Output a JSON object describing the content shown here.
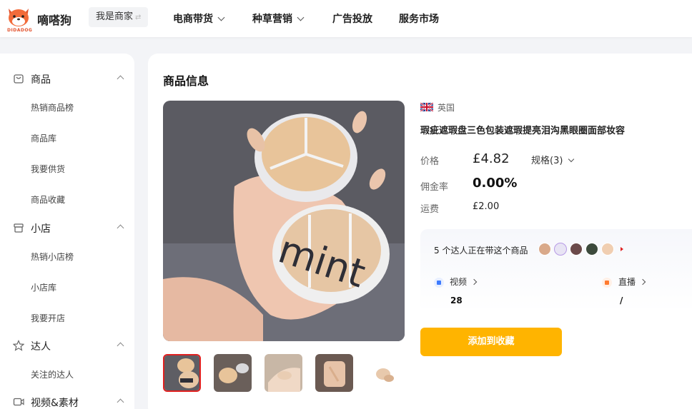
{
  "header": {
    "logo_text": "嘀嗒狗",
    "logo_sub": "DIDADOG",
    "merchant_label": "我是商家",
    "nav": [
      {
        "label": "电商带货",
        "has_dropdown": true
      },
      {
        "label": "种草营销",
        "has_dropdown": true
      },
      {
        "label": "广告投放",
        "has_dropdown": false
      },
      {
        "label": "服务市场",
        "has_dropdown": false
      }
    ]
  },
  "sidebar": {
    "groups": [
      {
        "label": "商品",
        "icon": "bag-icon",
        "items": [
          "热销商品榜",
          "商品库",
          "我要供货",
          "商品收藏"
        ]
      },
      {
        "label": "小店",
        "icon": "store-icon",
        "items": [
          "热销小店榜",
          "小店库",
          "我要开店"
        ]
      },
      {
        "label": "达人",
        "icon": "star-icon",
        "items": [
          "关注的达人"
        ]
      },
      {
        "label": "视频&素材",
        "icon": "video-icon",
        "items": []
      }
    ]
  },
  "product": {
    "section_title": "商品信息",
    "country": "英国",
    "title": "瑕疵遮瑕盘三色包装遮瑕提亮泪沟黑眼圈面部妆容",
    "price_label": "价格",
    "price": "£4.82",
    "spec_label": "规格(3)",
    "commission_label": "佣金率",
    "commission": "0.00%",
    "shipping_label": "运费",
    "shipping": "£2.00",
    "creators_text": "5 个达人正在带这个商品",
    "video_label": "视频",
    "video_count": "28",
    "live_label": "直播",
    "live_count": "/",
    "add_fav_label": "添加到收藏"
  },
  "colors": {
    "accent": "#ffb400",
    "brand": "#e2512c",
    "active_thumb_border": "#e02020"
  }
}
